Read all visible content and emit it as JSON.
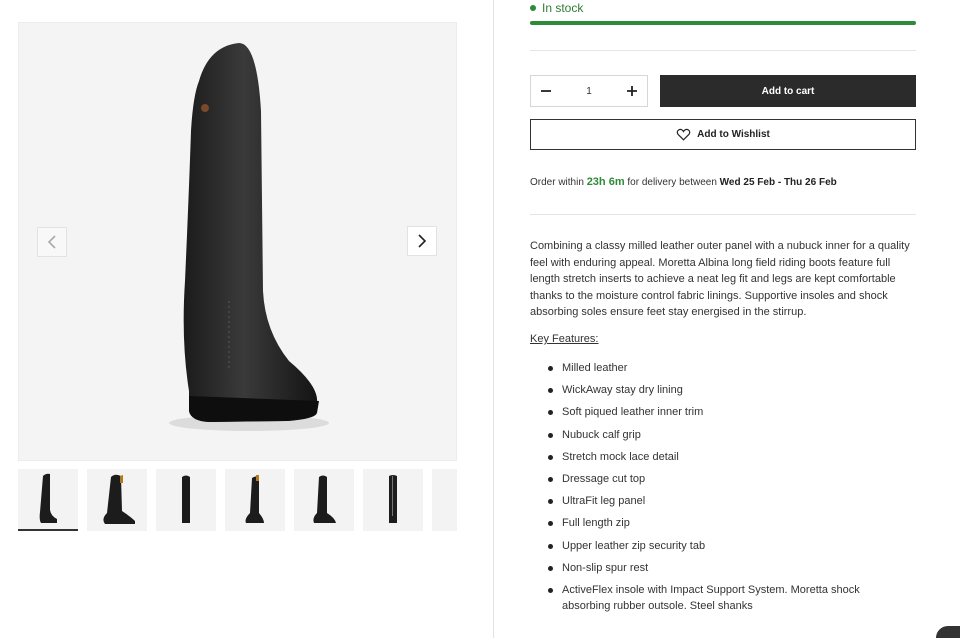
{
  "gallery": {
    "prev_icon": "chevron-left-icon",
    "next_icon": "chevron-right-icon",
    "thumbnail_count": 7,
    "active_thumbnail": 1
  },
  "stock": {
    "label": "In stock",
    "color": "#2f8a3a"
  },
  "purchase": {
    "quantity": "1",
    "minus": "−",
    "plus": "+",
    "add_to_cart": "Add to cart",
    "wishlist": "Add to Wishlist"
  },
  "delivery": {
    "prefix": "Order within",
    "countdown": "23h 6m",
    "middle": "for delivery between",
    "start": "Wed 25 Feb",
    "sep": " - ",
    "end": "Thu 26 Feb"
  },
  "description": "Combining a classy milled leather outer panel with a nubuck inner for a quality feel with enduring appeal. Moretta Albina long field riding boots feature full length stretch inserts to achieve a neat leg fit and legs are kept comfortable thanks to the moisture control fabric linings. Supportive insoles and shock absorbing soles ensure feet stay energised in the stirrup.",
  "key_features_title": "Key Features:",
  "features": [
    "Milled leather",
    "WickAway stay dry lining",
    "Soft piqued leather inner trim",
    "Nubuck calf grip",
    "Stretch mock lace detail",
    "Dressage cut top",
    "UltraFit leg panel",
    "Full length zip",
    "Upper leather zip security tab",
    "Non-slip spur rest",
    "ActiveFlex insole with Impact Support System. Moretta shock absorbing rubber outsole. Steel shanks"
  ]
}
